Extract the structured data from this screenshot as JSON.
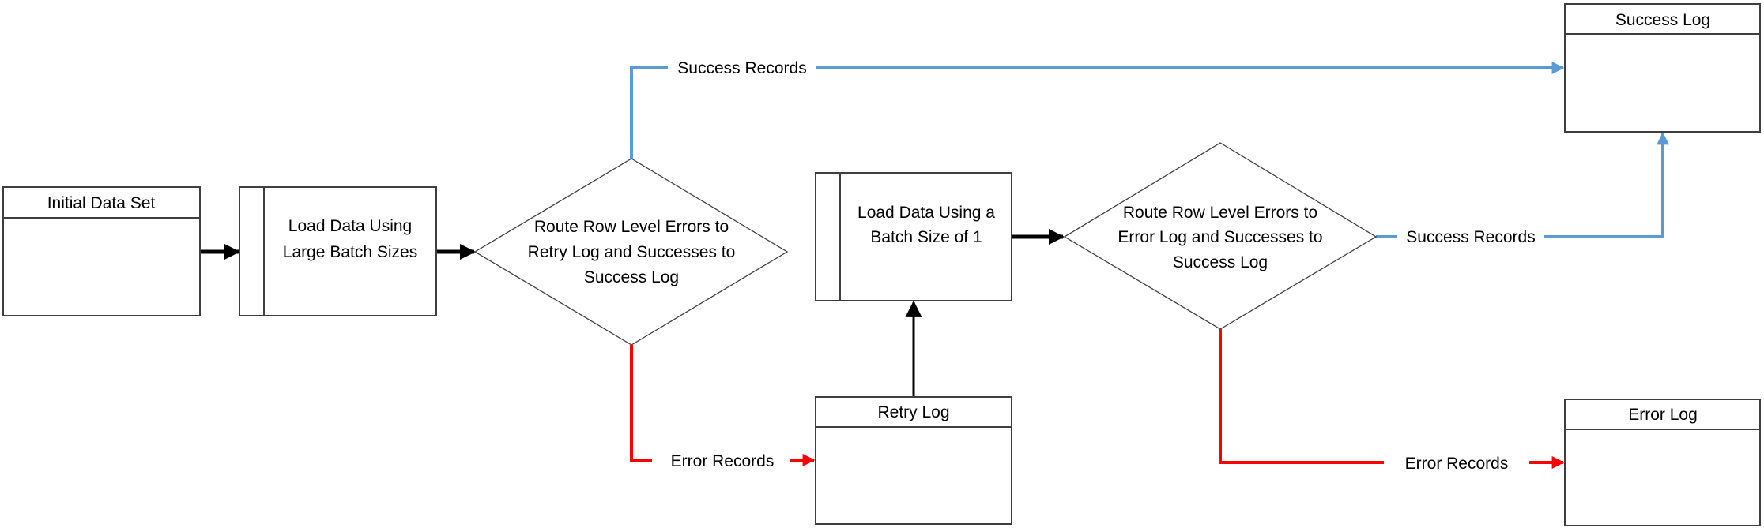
{
  "colors": {
    "success": "#5B9BD5",
    "error": "#FF0000",
    "flow": "#000000"
  },
  "nodes": {
    "initial_data_set": {
      "title": "Initial Data Set"
    },
    "load_large": {
      "lines": [
        "Load Data Using",
        "Large Batch Sizes"
      ]
    },
    "route_retry": {
      "lines": [
        "Route Row Level Errors to",
        "Retry Log and Successes to",
        "Success Log"
      ]
    },
    "load_single": {
      "lines": [
        "Load Data Using a",
        "Batch Size of 1"
      ]
    },
    "route_error": {
      "lines": [
        "Route Row Level Errors to",
        "Error Log and Successes to",
        "Success Log"
      ]
    },
    "retry_log": {
      "title": "Retry Log"
    },
    "success_log": {
      "title": "Success Log"
    },
    "error_log": {
      "title": "Error Log"
    }
  },
  "edges": {
    "success_1": "Success Records",
    "error_1": "Error Records",
    "success_2": "Success Records",
    "error_2": "Error Records"
  }
}
